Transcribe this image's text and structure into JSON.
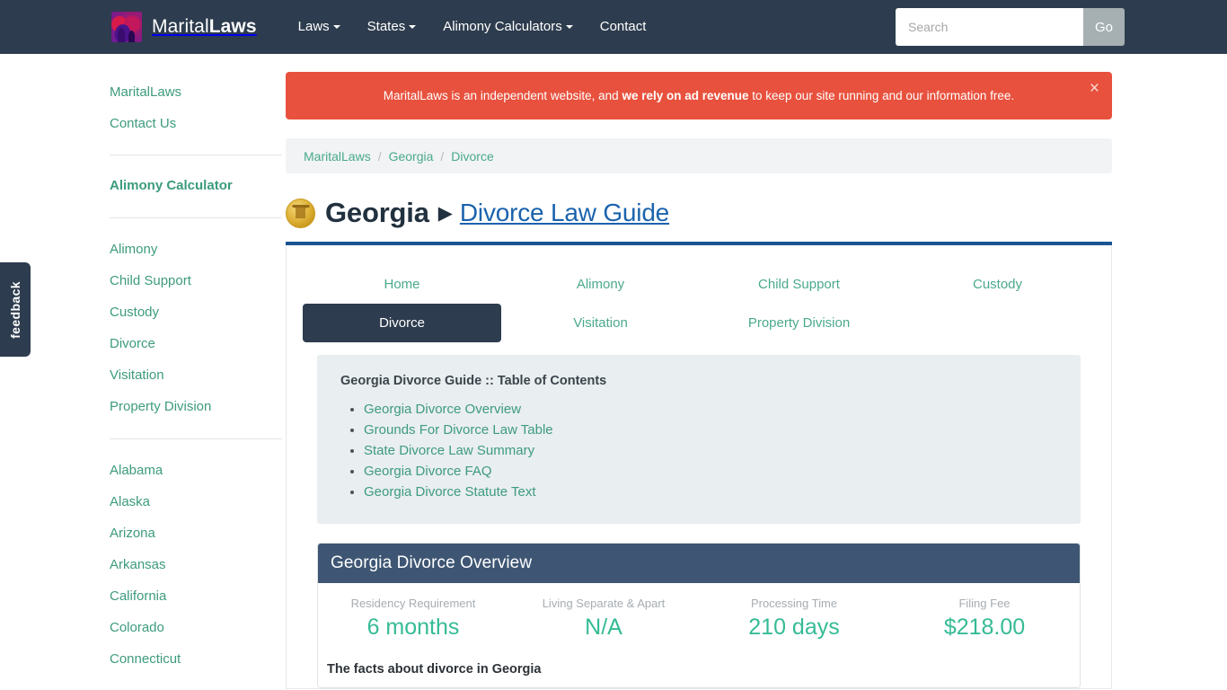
{
  "navbar": {
    "brand_first": "Marital",
    "brand_second": "Laws",
    "logo_icon": "heart-couple-logo-icon",
    "links": [
      {
        "label": "Laws",
        "caret": true
      },
      {
        "label": "States",
        "caret": true
      },
      {
        "label": "Alimony Calculators",
        "caret": true
      },
      {
        "label": "Contact",
        "caret": false
      }
    ],
    "search": {
      "placeholder": "Search",
      "value": "",
      "button_label": "Go"
    }
  },
  "feedback": {
    "label": "feedback"
  },
  "sidebar": {
    "group1": [
      {
        "label": "MaritalLaws"
      },
      {
        "label": "Contact Us"
      }
    ],
    "group2": [
      {
        "label": "Alimony Calculator",
        "bold": true
      }
    ],
    "group3": [
      {
        "label": "Alimony"
      },
      {
        "label": "Child Support"
      },
      {
        "label": "Custody"
      },
      {
        "label": "Divorce"
      },
      {
        "label": "Visitation"
      },
      {
        "label": "Property Division"
      }
    ],
    "group4": [
      {
        "label": "Alabama"
      },
      {
        "label": "Alaska"
      },
      {
        "label": "Arizona"
      },
      {
        "label": "Arkansas"
      },
      {
        "label": "California"
      },
      {
        "label": "Colorado"
      },
      {
        "label": "Connecticut"
      }
    ]
  },
  "alert": {
    "text_before": "MaritalLaws is an independent website, and ",
    "text_bold": "we rely on ad revenue",
    "text_after": " to keep our site running and our information free.",
    "close_label": "×",
    "background": "#e8513d"
  },
  "breadcrumb": {
    "items": [
      "MaritalLaws",
      "Georgia",
      "Divorce"
    ],
    "separator": "/"
  },
  "page_title": {
    "seal_icon": "georgia-state-seal-icon",
    "state": "Georgia",
    "arrow": "▶",
    "guide": "Divorce Law Guide",
    "rule_color": "#1a5494"
  },
  "tabs": [
    {
      "label": "Home",
      "active": false
    },
    {
      "label": "Alimony",
      "active": false
    },
    {
      "label": "Child Support",
      "active": false
    },
    {
      "label": "Custody",
      "active": false
    },
    {
      "label": "Divorce",
      "active": true
    },
    {
      "label": "Visitation",
      "active": false
    },
    {
      "label": "Property Division",
      "active": false
    }
  ],
  "toc": {
    "title": "Georgia Divorce Guide :: Table of Contents",
    "items": [
      "Georgia Divorce Overview",
      "Grounds For Divorce Law Table",
      "State Divorce Law Summary",
      "Georgia Divorce FAQ",
      "Georgia Divorce Statute Text"
    ]
  },
  "overview": {
    "heading": "Georgia Divorce Overview",
    "stats": [
      {
        "label": "Residency Requirement",
        "value": "6 months"
      },
      {
        "label": "Living Separate & Apart",
        "value": "N/A"
      },
      {
        "label": "Processing Time",
        "value": "210 days"
      },
      {
        "label": "Filing Fee",
        "value": "$218.00"
      }
    ],
    "facts_heading": "The facts about divorce in Georgia",
    "value_color": "#35bb95"
  }
}
